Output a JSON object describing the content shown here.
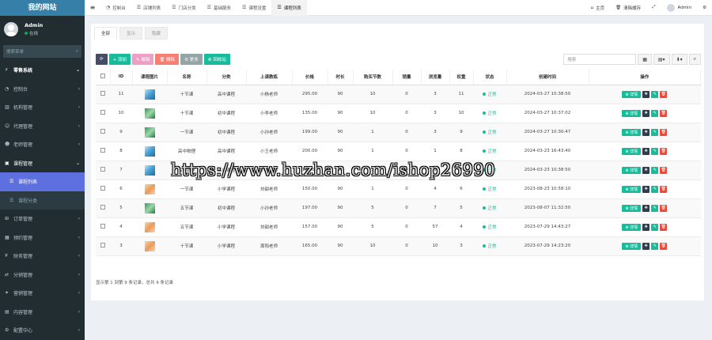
{
  "sidebar": {
    "logo": "我的网站",
    "user": {
      "name": "Admin",
      "status": "在线"
    },
    "search_placeholder": "搜索菜单",
    "items": [
      {
        "label": "零售系统",
        "icon": "bolt-icon",
        "type": "header"
      },
      {
        "label": "控制台",
        "icon": "dashboard-icon",
        "type": "item"
      },
      {
        "label": "机构管理",
        "icon": "building-icon",
        "type": "item"
      },
      {
        "label": "代理管理",
        "icon": "users-icon",
        "type": "item"
      },
      {
        "label": "老师管理",
        "icon": "user-icon",
        "type": "item"
      },
      {
        "label": "课程管理",
        "icon": "book-icon",
        "type": "open"
      },
      {
        "label": "课程列表",
        "icon": "list-icon",
        "type": "sub-active"
      },
      {
        "label": "课程分类",
        "icon": "list-icon",
        "type": "sub"
      },
      {
        "label": "订单管理",
        "icon": "cart-icon",
        "type": "item"
      },
      {
        "label": "预约管理",
        "icon": "calendar-icon",
        "type": "item"
      },
      {
        "label": "财务管理",
        "icon": "money-icon",
        "type": "item"
      },
      {
        "label": "分销管理",
        "icon": "share-icon",
        "type": "item"
      },
      {
        "label": "营销管理",
        "icon": "gift-icon",
        "type": "item"
      },
      {
        "label": "内容管理",
        "icon": "file-icon",
        "type": "item"
      },
      {
        "label": "配置中心",
        "icon": "gear-icon",
        "type": "item"
      }
    ]
  },
  "topbar": {
    "tabs": [
      {
        "label": "控制台",
        "icon": "dashboard-icon",
        "active": false
      },
      {
        "label": "店铺列表",
        "icon": "list-icon",
        "active": false
      },
      {
        "label": "门店分类",
        "icon": "list-icon",
        "active": false
      },
      {
        "label": "基础服务",
        "icon": "list-icon",
        "active": false
      },
      {
        "label": "课程设置",
        "icon": "list-icon",
        "active": false
      },
      {
        "label": "课程列表",
        "icon": "list-icon",
        "active": true
      }
    ],
    "home": "主页",
    "clear_cache": "清除缓存",
    "admin": "Admin"
  },
  "subtabs": [
    "全部",
    "显示",
    "隐藏"
  ],
  "toolbar": {
    "refresh": "",
    "add": "+ 添加",
    "edit": "✎ 编辑",
    "delete": "🗑 删除",
    "more": "⚙ 更多",
    "recycle": "♻ 回收站",
    "search_placeholder": "搜索"
  },
  "table": {
    "headers": [
      "",
      "ID",
      "课程图片",
      "名称",
      "分类",
      "上课教练",
      "价格",
      "时长",
      "购买节数",
      "销量",
      "浏览量",
      "权重",
      "状态",
      "创建时间",
      "操作"
    ],
    "rows": [
      {
        "id": "11",
        "thumb": "blue",
        "name": "十节课",
        "category": "高中课程",
        "teacher": "小杨老师",
        "price": "295.00",
        "duration": "90",
        "lessons": "10",
        "sales": "0",
        "views": "3",
        "weight": "11",
        "status": "正常",
        "created": "2024-03-27 10:38:50"
      },
      {
        "id": "10",
        "thumb": "green",
        "name": "十节课",
        "category": "初中课程",
        "teacher": "小李老师",
        "price": "135.00",
        "duration": "90",
        "lessons": "10",
        "sales": "0",
        "views": "3",
        "weight": "10",
        "status": "正常",
        "created": "2024-03-27 10:37:02"
      },
      {
        "id": "9",
        "thumb": "green",
        "name": "一节课",
        "category": "初中课程",
        "teacher": "小孙老师",
        "price": "199.00",
        "duration": "90",
        "lessons": "1",
        "sales": "0",
        "views": "3",
        "weight": "9",
        "status": "正常",
        "created": "2024-03-27 10:30:47"
      },
      {
        "id": "8",
        "thumb": "blue",
        "name": "高中物理",
        "category": "高中课程",
        "teacher": "小王老师",
        "price": "200.00",
        "duration": "90",
        "lessons": "1",
        "sales": "0",
        "views": "1",
        "weight": "8",
        "status": "正常",
        "created": "2024-03-23 16:43:40"
      },
      {
        "id": "7",
        "thumb": "blue",
        "name": "高中数学",
        "category": "高中课程",
        "teacher": "小杨老师",
        "price": "150.00",
        "duration": "90",
        "lessons": "1",
        "sales": "0",
        "views": "1",
        "weight": "7",
        "status": "正常",
        "created": "2024-03-23 10:38:50"
      },
      {
        "id": "6",
        "thumb": "orange",
        "name": "一节课",
        "category": "小学课程",
        "teacher": "刘甜老师",
        "price": "150.00",
        "duration": "90",
        "lessons": "1",
        "sales": "0",
        "views": "4",
        "weight": "6",
        "status": "正常",
        "created": "2023-08-23 10:58:10"
      },
      {
        "id": "5",
        "thumb": "green",
        "name": "五节课",
        "category": "初中课程",
        "teacher": "小孙老师",
        "price": "197.00",
        "duration": "90",
        "lessons": "5",
        "sales": "0",
        "views": "7",
        "weight": "5",
        "status": "正常",
        "created": "2023-08-07 11:32:50"
      },
      {
        "id": "4",
        "thumb": "orange",
        "name": "五节课",
        "category": "小学课程",
        "teacher": "刘甜老师",
        "price": "157.00",
        "duration": "90",
        "lessons": "5",
        "sales": "0",
        "views": "57",
        "weight": "4",
        "status": "正常",
        "created": "2023-07-29 14:43:27"
      },
      {
        "id": "3",
        "thumb": "orange",
        "name": "十节课",
        "category": "小学课程",
        "teacher": "周阳老师",
        "price": "165.00",
        "duration": "90",
        "lessons": "10",
        "sales": "0",
        "views": "10",
        "weight": "3",
        "status": "正常",
        "created": "2023-07-29 14:23:20"
      }
    ],
    "op_detail": "⊕ 详情"
  },
  "footer_info": "显示第 1 到第 9 条记录，总共 9 条记录",
  "watermark": "https://www.huzhan.com/ishop26990"
}
